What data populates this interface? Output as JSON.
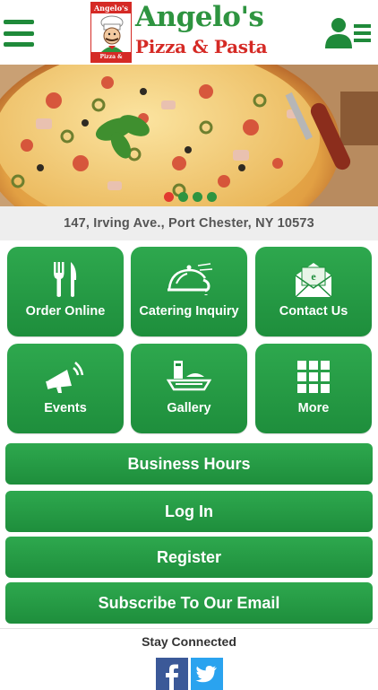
{
  "header": {
    "logo_top": "Angelo's",
    "logo_badge_bottom": "Pizza & Pasta",
    "logo_title": "Angelo's",
    "logo_subtitle": "Pizza & Pasta"
  },
  "carousel": {
    "slide_count": 4,
    "active_index": 0
  },
  "address": "147, Irving Ave., Port Chester, NY 10573",
  "tiles": [
    {
      "label": "Order Online",
      "icon": "fork-knife-icon"
    },
    {
      "label": "Catering Inquiry",
      "icon": "cloche-icon"
    },
    {
      "label": "Contact Us",
      "icon": "envelope-icon"
    },
    {
      "label": "Events",
      "icon": "megaphone-icon"
    },
    {
      "label": "Gallery",
      "icon": "tray-icon"
    },
    {
      "label": "More",
      "icon": "grid-icon"
    }
  ],
  "buttons": {
    "business_hours": "Business Hours",
    "log_in": "Log In",
    "register": "Register",
    "subscribe": "Subscribe To Our Email"
  },
  "footer": {
    "stay_connected": "Stay Connected"
  },
  "colors": {
    "brand_green": "#2e9440",
    "button_green": "#23963f",
    "brand_red": "#d52a25",
    "facebook": "#3b5998",
    "twitter": "#2aa3ef"
  }
}
